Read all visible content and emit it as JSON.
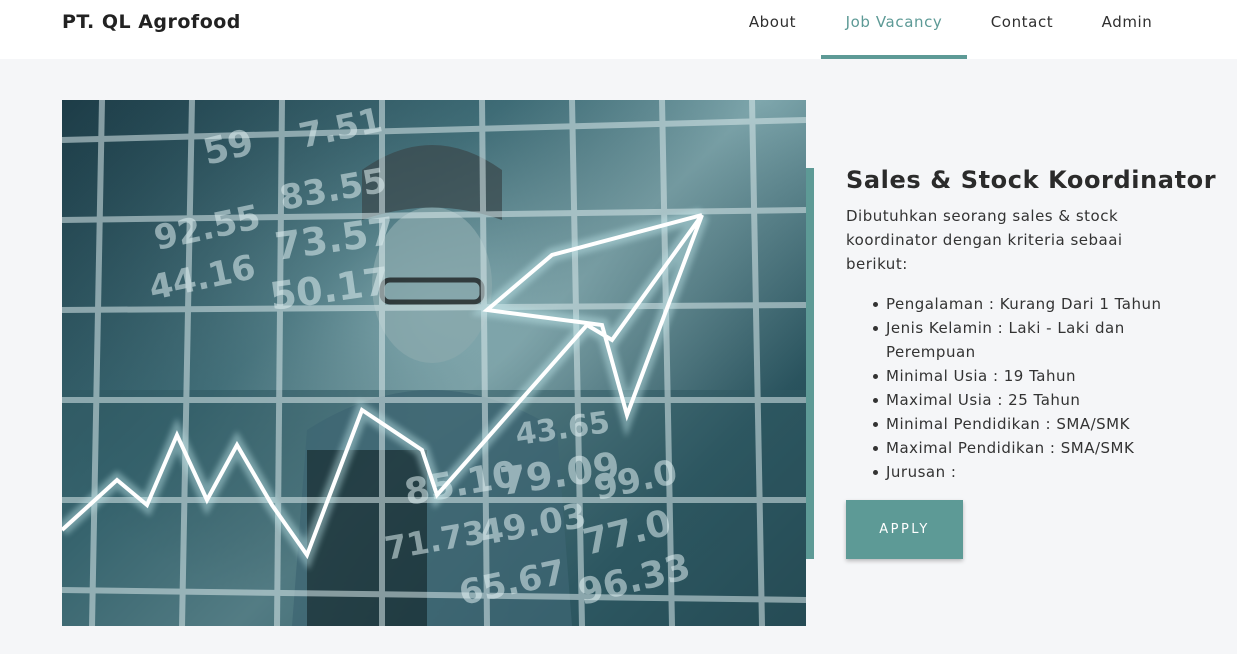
{
  "brand": "PT. QL Agrofood",
  "nav": {
    "items": [
      {
        "label": "About"
      },
      {
        "label": "Job Vacancy"
      },
      {
        "label": "Contact"
      },
      {
        "label": "Admin"
      }
    ],
    "active": "Job Vacancy"
  },
  "hero_image": {
    "description_icon": "man-with-stock-chart-image",
    "ticker_numbers": [
      "59",
      "7.51",
      "83.55",
      "73.57",
      "50.17",
      "92.55",
      "44.16",
      "79.09",
      "49.03",
      "77.0",
      "96.33",
      "65.67",
      "43.65",
      "85.10",
      "99.0",
      "71.73"
    ]
  },
  "job": {
    "title": "Sales & Stock Koordinator",
    "description": "Dibutuhkan seorang sales & stock koordinator dengan kriteria sebaai berikut:",
    "requirements": [
      "Pengalaman : Kurang Dari 1 Tahun",
      "Jenis Kelamin : Laki - Laki dan Perempuan",
      "Minimal Usia : 19 Tahun",
      "Maximal Usia : 25 Tahun",
      "Minimal Pendidikan : SMA/SMK",
      "Maximal Pendidikan : SMA/SMK",
      "Jurusan :"
    ],
    "apply_label": "APPLY"
  },
  "colors": {
    "accent": "#5d9a96",
    "background": "#f5f6f8",
    "navbar": "#ffffff"
  }
}
